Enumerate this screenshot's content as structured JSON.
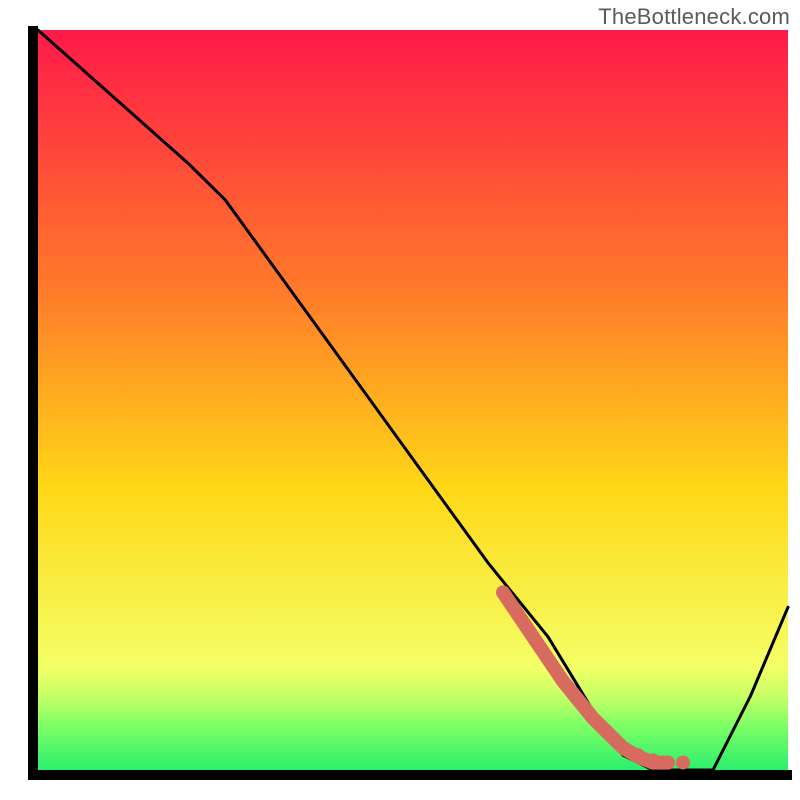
{
  "watermark": "TheBottleneck.com",
  "colors": {
    "gradient_top": "#ff1a49",
    "gradient_mid1": "#ff7a2a",
    "gradient_mid2": "#ffd817",
    "gradient_green_top": "#f4ff66",
    "gradient_green": "#2bef6b",
    "axis": "#000000",
    "curve": "#000000",
    "highlight": "#d76b60"
  },
  "chart_data": {
    "type": "line",
    "title": "",
    "xlabel": "",
    "ylabel": "",
    "xlim": [
      0,
      100
    ],
    "ylim": [
      0,
      100
    ],
    "grid": false,
    "series": [
      {
        "name": "bottleneck-curve",
        "x": [
          0,
          10,
          20,
          25,
          30,
          40,
          50,
          60,
          68,
          74,
          78,
          82,
          86,
          90,
          95,
          100
        ],
        "y": [
          100,
          91,
          82,
          77,
          70,
          56,
          42,
          28,
          18,
          8,
          2,
          0,
          0,
          0,
          10,
          22
        ]
      }
    ],
    "highlight_segment": {
      "x": [
        62,
        64,
        66,
        68,
        70,
        72,
        74,
        76,
        78,
        80,
        82,
        84
      ],
      "y": [
        24,
        21,
        18,
        15,
        12,
        9.5,
        7,
        5,
        3,
        1.8,
        1,
        1
      ]
    },
    "highlight_dots": {
      "x": [
        80,
        82,
        84,
        86
      ],
      "y": [
        2,
        1.3,
        1,
        1
      ]
    }
  }
}
